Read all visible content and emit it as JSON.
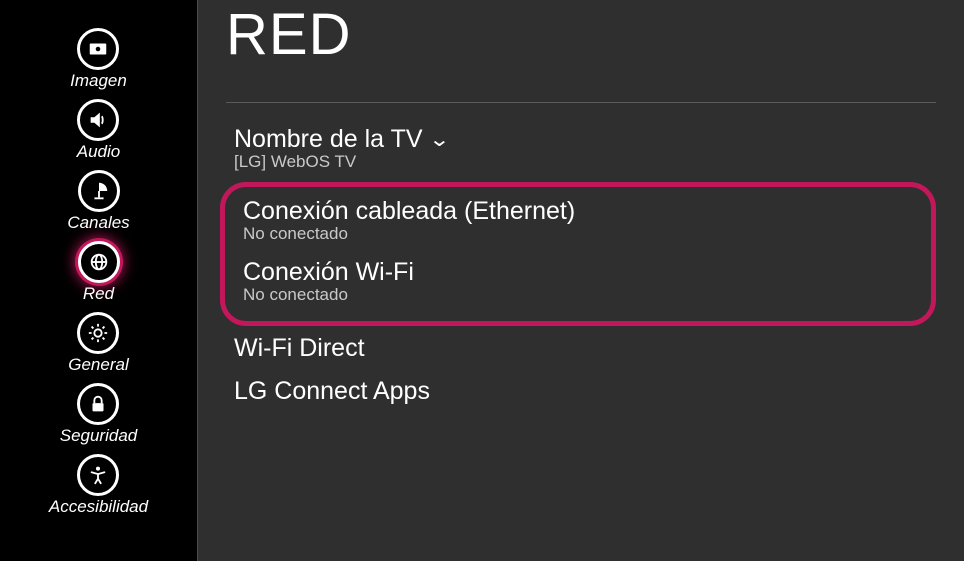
{
  "sidebar": {
    "items": [
      {
        "label": "Imagen",
        "icon": "image-icon",
        "selected": false
      },
      {
        "label": "Audio",
        "icon": "speaker-icon",
        "selected": false
      },
      {
        "label": "Canales",
        "icon": "satellite-icon",
        "selected": false
      },
      {
        "label": "Red",
        "icon": "globe-icon",
        "selected": true
      },
      {
        "label": "General",
        "icon": "gear-icon",
        "selected": false
      },
      {
        "label": "Seguridad",
        "icon": "lock-icon",
        "selected": false
      },
      {
        "label": "Accesibilidad",
        "icon": "accessibility-icon",
        "selected": false
      }
    ]
  },
  "main": {
    "title": "RED",
    "rows": [
      {
        "title": "Nombre de la TV",
        "sub": "[LG] WebOS TV",
        "hasChevron": true
      },
      {
        "title": "Conexión cableada (Ethernet)",
        "sub": "No conectado"
      },
      {
        "title": "Conexión Wi-Fi",
        "sub": "No conectado"
      },
      {
        "title": "Wi-Fi Direct"
      },
      {
        "title": "LG Connect Apps"
      }
    ]
  },
  "colors": {
    "accent": "#c2185b",
    "bgMain": "#2f2f2f",
    "bgSidebar": "#000000"
  }
}
